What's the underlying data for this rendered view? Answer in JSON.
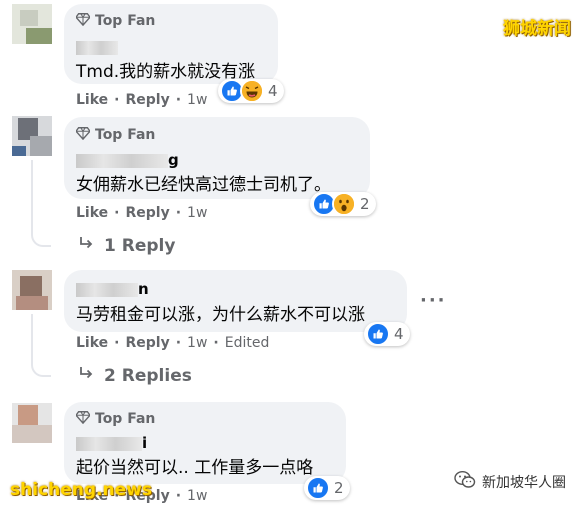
{
  "watermarks": {
    "top_right": "狮城新闻",
    "bottom_left": "shicheng.news",
    "wechat_account": "新加坡华人圈"
  },
  "colors": {
    "bubble": "#f0f2f5",
    "secondary_text": "#65676b",
    "like_blue": "#1877f2",
    "emoji_yellow": "#f7b125",
    "watermark_yellow": "#ffd400"
  },
  "comments": [
    {
      "badge": "Top Fan",
      "text": "Tmd.我的薪水就没有涨",
      "actions": {
        "like": "Like",
        "reply": "Reply",
        "time": "1w"
      },
      "reactions": {
        "icons": [
          "like-icon",
          "laugh-icon"
        ],
        "count": "4"
      }
    },
    {
      "badge": "Top Fan",
      "name_suffix": "g",
      "text": "女佣薪水已经快高过德士司机了。",
      "actions": {
        "like": "Like",
        "reply": "Reply",
        "time": "1w"
      },
      "reactions": {
        "icons": [
          "like-icon",
          "wow-icon"
        ],
        "count": "2"
      },
      "replies_link": "1 Reply"
    },
    {
      "name_suffix": "n",
      "text": "马劳租金可以涨，为什么薪水不可以涨",
      "actions": {
        "like": "Like",
        "reply": "Reply",
        "time": "1w",
        "edited": "Edited"
      },
      "reactions": {
        "icons": [
          "like-icon"
        ],
        "count": "4"
      },
      "replies_link": "2 Replies",
      "more": "···"
    },
    {
      "badge": "Top Fan",
      "name_suffix": "i",
      "text": "起价当然可以.. 工作量多一点咯",
      "actions": {
        "like": "Like",
        "reply": "Reply",
        "time": "1w"
      },
      "reactions": {
        "icons": [
          "like-icon"
        ],
        "count": "2"
      }
    }
  ]
}
